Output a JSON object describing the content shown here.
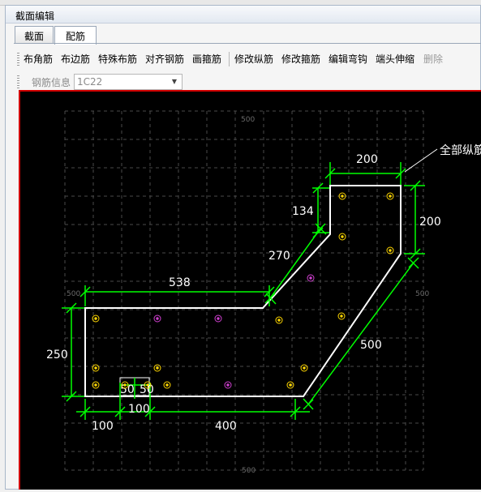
{
  "window": {
    "title": "截面编辑"
  },
  "tabs": [
    {
      "label": "截面",
      "active": false
    },
    {
      "label": "配筋",
      "active": true
    }
  ],
  "toolbar": {
    "items": [
      {
        "label": "布角筋",
        "enabled": true
      },
      {
        "label": "布边筋",
        "enabled": true
      },
      {
        "label": "特殊布筋",
        "enabled": true
      },
      {
        "label": "对齐钢筋",
        "enabled": true
      },
      {
        "label": "画箍筋",
        "enabled": true
      },
      {
        "label": "修改纵筋",
        "enabled": true
      },
      {
        "label": "修改箍筋",
        "enabled": true
      },
      {
        "label": "编辑弯钩",
        "enabled": true
      },
      {
        "label": "端头伸缩",
        "enabled": true
      },
      {
        "label": "删除",
        "enabled": false
      }
    ]
  },
  "rebar_info": {
    "label": "钢筋信息",
    "value": "1C22"
  },
  "drawing": {
    "callout": "全部纵筋",
    "dimensions": [
      "200",
      "200",
      "134",
      "270",
      "538",
      "500",
      "250",
      "50",
      "50",
      "100",
      "100",
      "400"
    ],
    "axis_labels": [
      "500",
      "500",
      "500",
      "500"
    ],
    "colors": {
      "background": "#000000",
      "outline": "#ffffff",
      "dimension": "#00ff00",
      "rebar_corner": "#ffd700",
      "rebar_edge": "#d040d0",
      "grid": "#4a4a4a"
    }
  }
}
